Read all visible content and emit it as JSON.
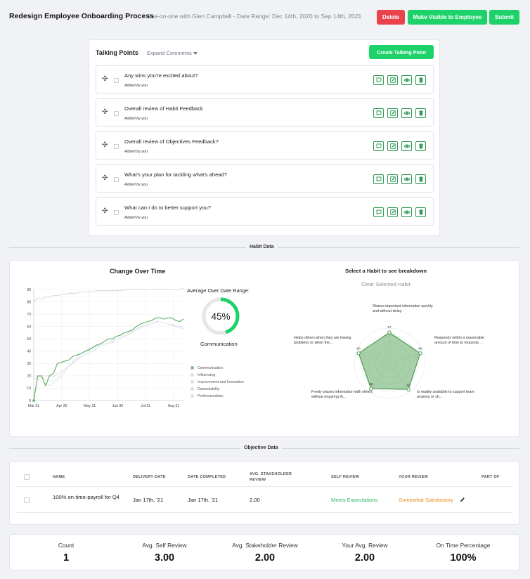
{
  "header": {
    "title": "Redesign Employee Onboarding Process",
    "subtitle": "One-on-one with Glen Campbell - Date Range: Dec 14th, 2020 to Sep 14th, 2021",
    "delete_label": "Delete",
    "make_visible_label": "Make Visible to Employee",
    "submit_label": "Submit"
  },
  "talking_points": {
    "title": "Talking Points",
    "expand_label": "Expand Comments",
    "create_label": "Create Talking Point",
    "items": [
      {
        "question": "Any wins you're excited about?",
        "added_by": "Added by you"
      },
      {
        "question": "Overall review of Habit Feedback",
        "added_by": "Added by you"
      },
      {
        "question": "Overall review of Objectives Feedback?",
        "added_by": "Added by you"
      },
      {
        "question": "What's your plan for tackling what's ahead?",
        "added_by": "Added by you"
      },
      {
        "question": "What can I do to better support you?",
        "added_by": "Added by you"
      }
    ],
    "action_icons": [
      "comment-icon",
      "edit-icon",
      "eye-icon",
      "trash-icon"
    ]
  },
  "habit_section": {
    "divider_label": "Habit Data",
    "change_title": "Change Over Time",
    "avg_label": "Average Over Date Range:",
    "avg_percent": "45%",
    "avg_value": 0.45,
    "avg_habit": "Communication",
    "breakdown_title": "Select a Habit to see breakdown",
    "clear_label": "Clear Selected Habit",
    "legend": [
      "Communication",
      "Influencing",
      "Improvement and Innovation",
      "Dependability",
      "Professionalism"
    ],
    "radar_labels": [
      "Shares important information quickly and without delay.",
      "Responds within a reasonable amount of time to requests ...",
      "Is readily available to support team projects or sh...",
      "Freely shares information with others without requiring th...",
      "Helps others when they are having problems or when the..."
    ],
    "radar_values": [
      "57",
      "60",
      "60",
      "58",
      "60"
    ]
  },
  "chart_data": {
    "type": "line",
    "title": "Change Over Time",
    "x_ticks": [
      "Mar 31",
      "Apr 30",
      "May 31",
      "Jun 30",
      "Jul 31",
      "Aug 31"
    ],
    "y_ticks": [
      "0",
      "10",
      "20",
      "30",
      "40",
      "50",
      "60",
      "70",
      "80",
      "90"
    ],
    "ylim": [
      0,
      90
    ],
    "series": [
      {
        "name": "Communication",
        "color": "#5ea860",
        "values": [
          0,
          20,
          20,
          12,
          20,
          22,
          30,
          31,
          32,
          33,
          36,
          37,
          38,
          40,
          41,
          43,
          45,
          46,
          48,
          50,
          50,
          52,
          53,
          55,
          56,
          57,
          60,
          62,
          63,
          64,
          65,
          67,
          67,
          66,
          67,
          67,
          65,
          64,
          66
        ]
      },
      {
        "name": "Influencing",
        "color": "#c9cdd2",
        "values": [
          80,
          83,
          82,
          84,
          84,
          85,
          85,
          86,
          86,
          87,
          87,
          87,
          88,
          88,
          88,
          88,
          89,
          89,
          89,
          89,
          89,
          89,
          89,
          90,
          90,
          90,
          90,
          90,
          90,
          90,
          90,
          90,
          90,
          90,
          90,
          90,
          90,
          90,
          91
        ]
      },
      {
        "name": "Improvement and Innovation",
        "color": "#d6d9dd",
        "values": [
          20,
          20,
          20,
          20,
          20,
          19,
          22,
          24,
          25,
          28,
          32,
          35,
          38,
          40,
          42,
          43,
          44,
          45,
          46,
          47,
          48,
          50,
          51,
          53,
          55,
          56,
          58,
          60,
          61,
          62,
          63,
          64,
          64,
          63,
          62,
          61,
          60,
          59,
          58
        ]
      },
      {
        "name": "Dependability",
        "color": "#dfe2e5",
        "values": [
          18,
          18,
          15,
          14,
          12,
          14,
          16,
          20,
          24,
          28,
          30,
          33,
          35,
          37,
          38,
          40,
          42,
          44,
          45,
          46,
          47,
          48,
          50,
          52,
          53,
          55,
          57,
          58,
          60,
          61,
          62,
          63,
          64,
          63,
          62,
          61,
          61,
          60,
          60
        ]
      },
      {
        "name": "Professionalism",
        "color": "#e6e8eb",
        "values": [
          20,
          20,
          18,
          17,
          16,
          16,
          18,
          22,
          26,
          29,
          31,
          34,
          36,
          38,
          40,
          41,
          43,
          45,
          46,
          47,
          49,
          50,
          51,
          53,
          54,
          56,
          58,
          59,
          60,
          61,
          62,
          63,
          64,
          63,
          62,
          62,
          61,
          60,
          59
        ]
      }
    ]
  },
  "objective_section": {
    "divider_label": "Objective Data",
    "headers": [
      "NAME",
      "DELIVERY DATE",
      "DATE COMPLETED",
      "AVG. STAKEHOLDER REVIEW",
      "SELF REVIEW",
      "YOUR REVIEW",
      "PART OF"
    ],
    "rows": [
      {
        "name": "100% on-time-payroll for Q4",
        "delivery_date": "Jan 17th, '21",
        "date_completed": "Jan 17th, '21",
        "avg_stakeholder": "2.00",
        "self_review": "Meets Expectations",
        "your_review": "Somewhat Satisfactory",
        "part_of": ""
      }
    ]
  },
  "stats": [
    {
      "label": "Count",
      "value": "1"
    },
    {
      "label": "Avg. Self Review",
      "value": "3.00"
    },
    {
      "label": "Avg. Stakeholder Review",
      "value": "2.00"
    },
    {
      "label": "Your Avg. Review",
      "value": "2.00"
    },
    {
      "label": "On Time Percentage",
      "value": "100%"
    }
  ],
  "colors": {
    "green": "#1ed26a",
    "red": "#e8424a",
    "self_review": "#2fb565",
    "your_review": "#f08a24"
  }
}
